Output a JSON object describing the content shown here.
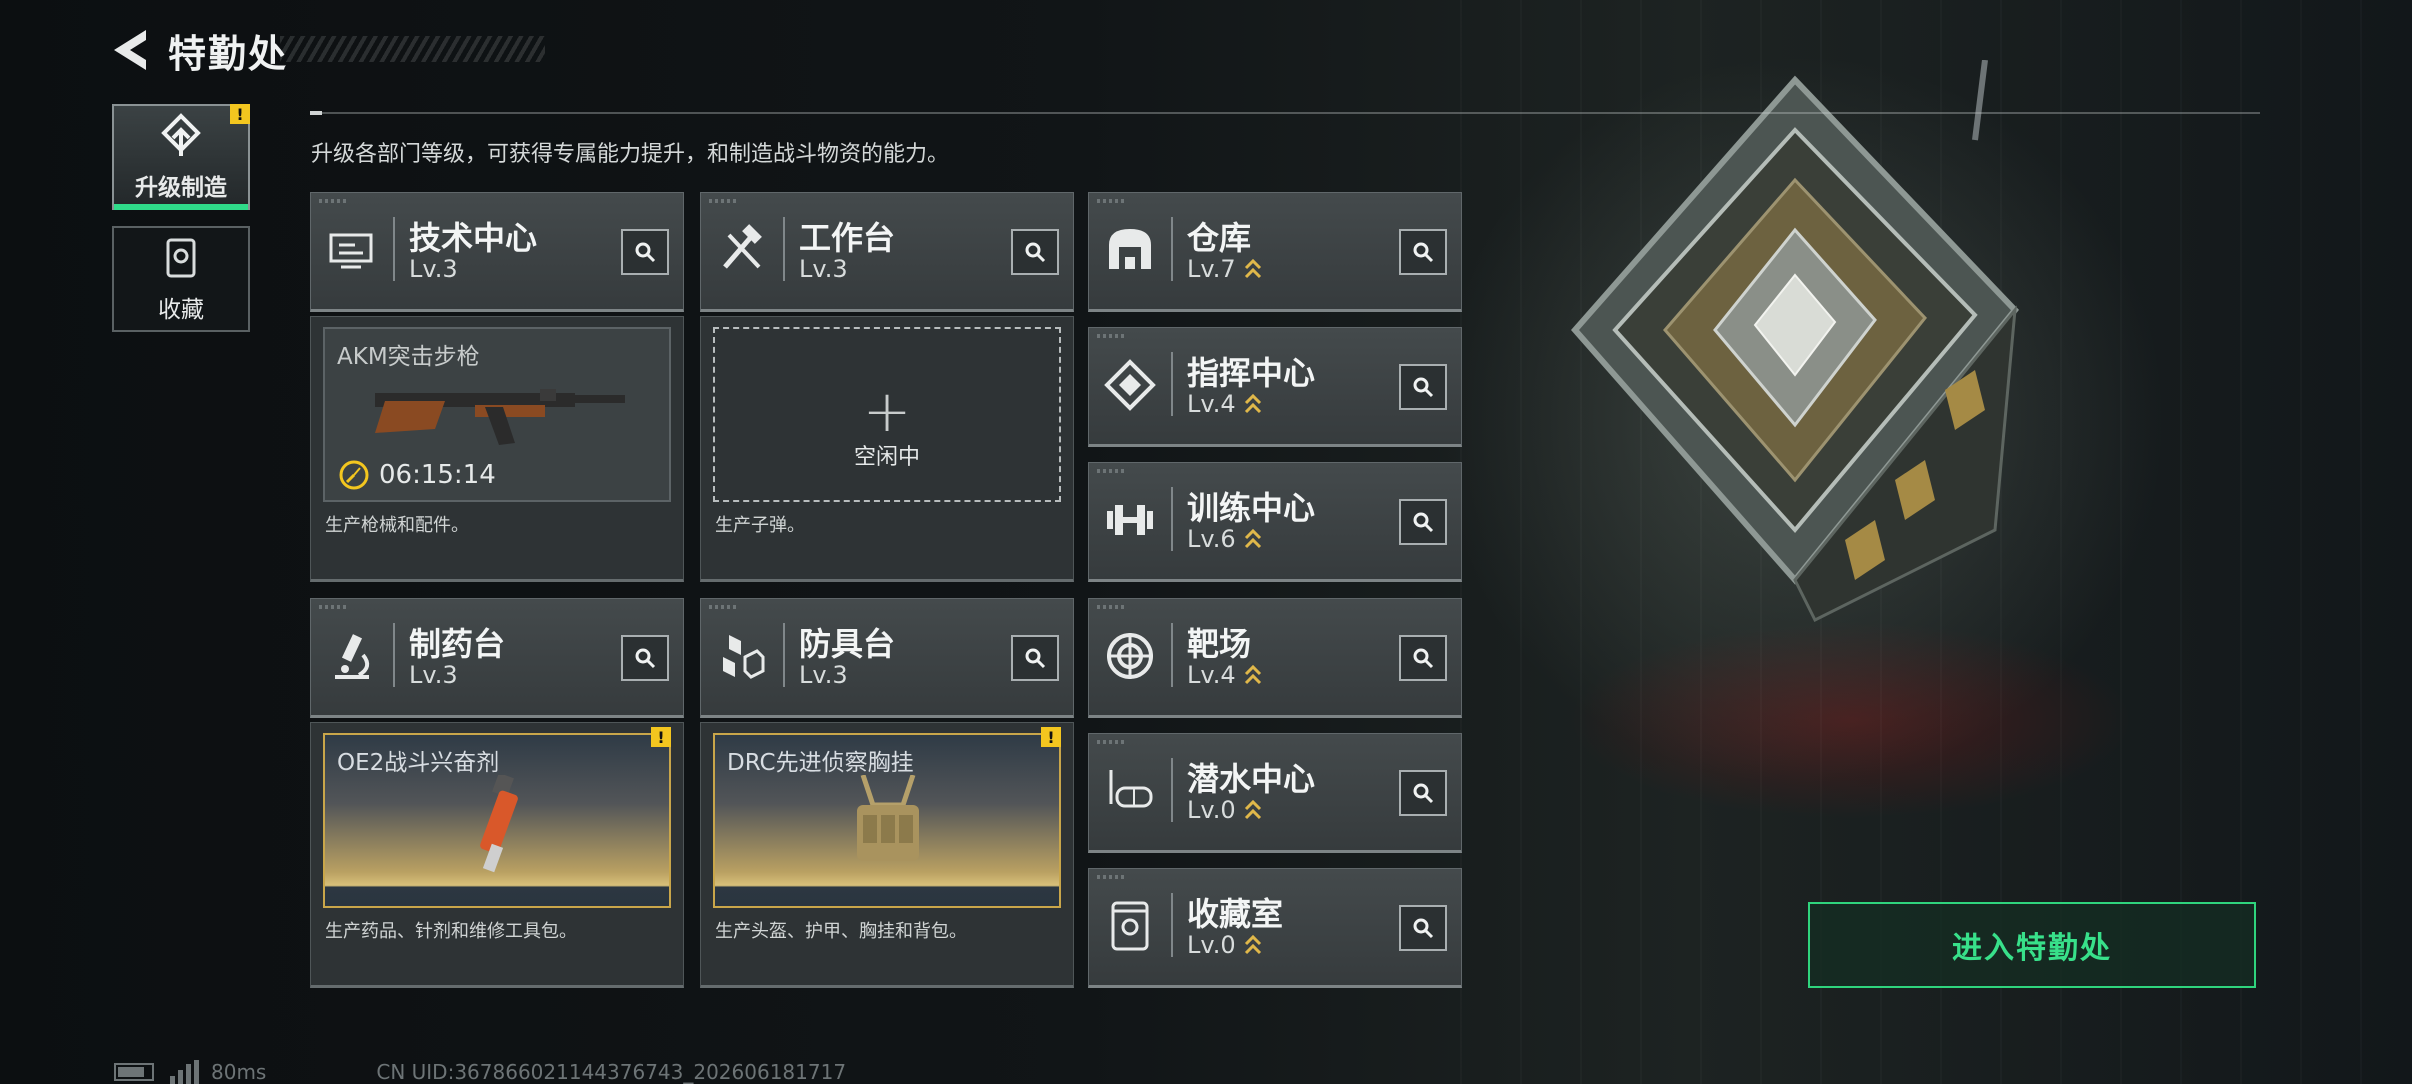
{
  "header": {
    "title": "特勤处"
  },
  "side_tabs": [
    {
      "label": "升级制造",
      "icon": "upgrade-icon",
      "active": true,
      "warning": "!"
    },
    {
      "label": "收藏",
      "icon": "collection-icon",
      "active": false
    }
  ],
  "subtitle": "升级各部门等级，可获得专属能力提升，和制造战斗物资的能力。",
  "departments": [
    {
      "name": "技术中心",
      "level": "Lv.3",
      "icon": "tech-center-icon",
      "upgradable": false
    },
    {
      "name": "工作台",
      "level": "Lv.3",
      "icon": "workbench-icon",
      "upgradable": false
    },
    {
      "name": "仓库",
      "level": "Lv.7",
      "icon": "warehouse-icon",
      "upgradable": true
    },
    {
      "name": "指挥中心",
      "level": "Lv.4",
      "icon": "command-center-icon",
      "upgradable": true
    },
    {
      "name": "训练中心",
      "level": "Lv.6",
      "icon": "training-center-icon",
      "upgradable": true
    },
    {
      "name": "制药台",
      "level": "Lv.3",
      "icon": "pharmacy-icon",
      "upgradable": false
    },
    {
      "name": "防具台",
      "level": "Lv.3",
      "icon": "armor-bench-icon",
      "upgradable": false
    },
    {
      "name": "靶场",
      "level": "Lv.4",
      "icon": "shooting-range-icon",
      "upgradable": true
    },
    {
      "name": "潜水中心",
      "level": "Lv.0",
      "icon": "diving-center-icon",
      "upgradable": true
    },
    {
      "name": "收藏室",
      "level": "Lv.0",
      "icon": "collection-room-icon",
      "upgradable": true
    }
  ],
  "production": {
    "tech": {
      "item": "AKM突击步枪",
      "timer": "06:15:14",
      "desc": "生产枪械和配件。"
    },
    "workbench": {
      "plus": "+",
      "idle": "空闲中",
      "desc": "生产子弹。"
    },
    "pharmacy": {
      "item": "OE2战斗兴奋剂",
      "desc": "生产药品、针剂和维修工具包。",
      "warning": "!"
    },
    "armor": {
      "item": "DRC先进侦察胸挂",
      "desc": "生产头盔、护甲、胸挂和背包。",
      "warning": "!"
    }
  },
  "enter_button": "进入特勤处",
  "status": {
    "ping": "80ms",
    "uid": "CN UID:367866021144376743_202606181717"
  },
  "colors": {
    "accent_green": "#2fd47d",
    "warning_yellow": "#f3c61f",
    "upgrade_gold": "#e0b84a"
  }
}
